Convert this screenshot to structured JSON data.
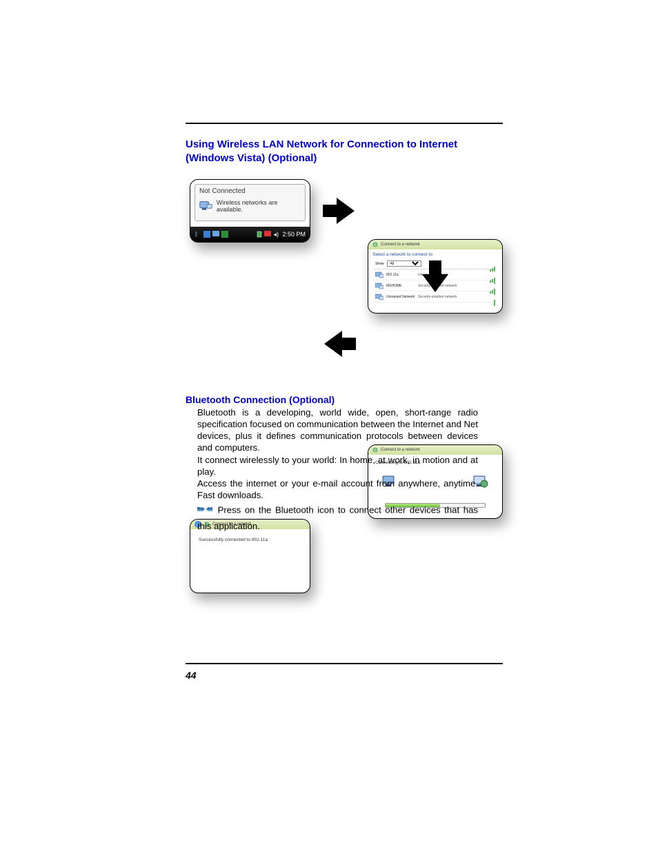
{
  "headings": {
    "wlan": "Using Wireless LAN Network for Connection to Internet (Windows Vista) (Optional)",
    "bluetooth": "Bluetooth Connection (Optional)"
  },
  "bluetooth_text": {
    "p1": "Bluetooth is a developing, world wide, open, short-range radio specification focused on communication between the Internet and Net devices, plus it defines communication protocols between devices and computers.",
    "p2": "It connect wirelessly to your world: In home, at work, in motion and at play.",
    "p3": "Access the internet or your e-mail account from anywhere, anytime. Fast downloads.",
    "p4": "Press on the Bluetooth icon to connect other devices that has this application.",
    "bt_icon_label": "BlueSoleil"
  },
  "page_number": "44",
  "panelA": {
    "tooltip_title": "Not Connected",
    "tooltip_msg": "Wireless networks are available.",
    "tray_time": "2:50 PM"
  },
  "panelB": {
    "window_title": "Connect to a network",
    "prompt": "Select a network to connect to",
    "show_label": "Show",
    "show_value": "All",
    "networks": [
      {
        "name": "802.11a",
        "type": "Unsecured network"
      },
      {
        "name": "MSHOME",
        "type": "Security-enabled network"
      },
      {
        "name": "Unnamed Network",
        "type": "Security-enabled network"
      }
    ]
  },
  "panelC": {
    "window_title": "Connect to a network",
    "status": "Connecting to 802.11a"
  },
  "panelD": {
    "window_title": "Connect to a network",
    "status": "Successfully connected to 802.11a"
  }
}
